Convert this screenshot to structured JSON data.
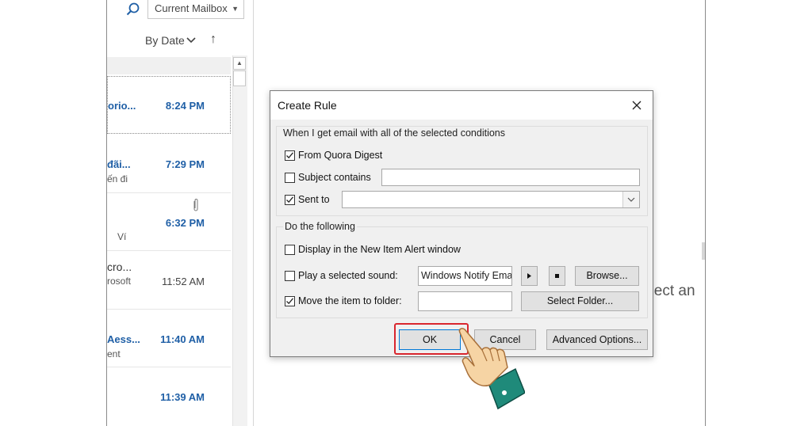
{
  "outlook": {
    "search_scope": "Current Mailbox",
    "sort_label": "By Date",
    "reading_pane_text": "elect an",
    "emails": [
      {
        "sender": "orio...",
        "sub": "",
        "time": "8:24 PM",
        "unread": true,
        "selected": true
      },
      {
        "sender": "đãi...",
        "sub": "ến đi",
        "time": "7:29 PM",
        "unread": true,
        "selected": false
      },
      {
        "sender": "",
        "sub": "Ví",
        "time": "6:32 PM",
        "unread": true,
        "selected": false,
        "attachment": true
      },
      {
        "sender": "cro...",
        "sub": "rosoft",
        "time": "11:52 AM",
        "unread": false,
        "selected": false
      },
      {
        "sender": "Aess...",
        "sub": "ent",
        "time": "11:40 AM",
        "unread": true,
        "selected": false
      },
      {
        "sender": "",
        "sub": "",
        "time": "11:39 AM",
        "unread": true,
        "selected": false
      }
    ]
  },
  "dialog": {
    "title": "Create Rule",
    "conditions_title": "When I get email with all of the selected conditions",
    "from_label": "From Quora Digest",
    "from_checked": true,
    "subject_label": "Subject contains",
    "subject_checked": false,
    "subject_value": "",
    "sent_to_label": "Sent to",
    "sent_to_checked": true,
    "sent_to_value": "",
    "actions_title": "Do the following",
    "alert_label": "Display in the New Item Alert window",
    "alert_checked": false,
    "sound_label": "Play a selected sound:",
    "sound_checked": false,
    "sound_value": "Windows Notify Ema",
    "browse_label": "Browse...",
    "move_label": "Move the item to folder:",
    "move_checked": true,
    "move_value": "",
    "select_folder_label": "Select Folder...",
    "ok_label": "OK",
    "cancel_label": "Cancel",
    "advanced_label": "Advanced Options..."
  },
  "colors": {
    "unread_accent": "#1f5fa6",
    "highlight": "#d9262e",
    "dialog_bg": "#f0f0f0"
  }
}
